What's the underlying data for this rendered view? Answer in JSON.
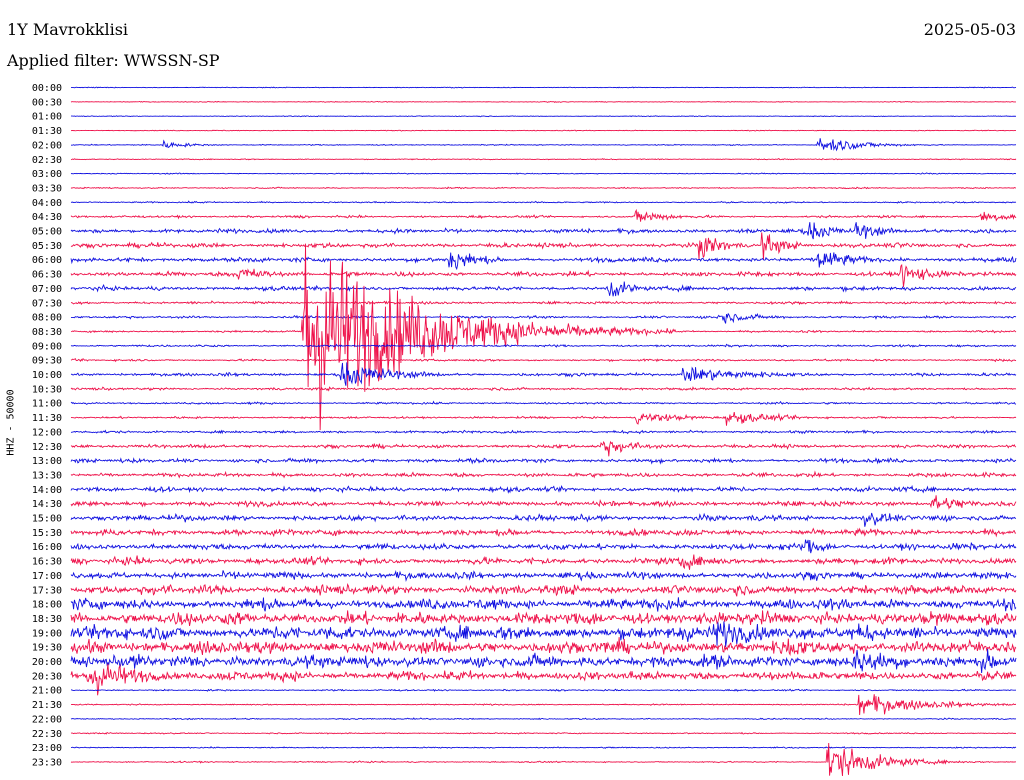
{
  "header": {
    "station": "1Y Mavrokklisi",
    "date": "2025-05-03",
    "filter": "Applied filter: WWSSN-SP"
  },
  "chart_data": {
    "type": "line",
    "subtype": "helicorder",
    "ylabel": "HHZ - 50000",
    "trace_colors": [
      "#1010e0",
      "#ee1049"
    ],
    "rows": [
      "00:00",
      "00:30",
      "01:00",
      "01:30",
      "02:00",
      "02:30",
      "03:00",
      "03:30",
      "04:00",
      "04:30",
      "05:00",
      "05:30",
      "06:00",
      "06:30",
      "07:00",
      "07:30",
      "08:00",
      "08:30",
      "09:00",
      "09:30",
      "10:00",
      "10:30",
      "11:00",
      "11:30",
      "12:00",
      "12:30",
      "13:00",
      "13:30",
      "14:00",
      "14:30",
      "15:00",
      "15:30",
      "16:00",
      "16:30",
      "17:00",
      "17:30",
      "18:00",
      "18:30",
      "19:00",
      "19:30",
      "20:00",
      "20:30",
      "21:00",
      "21:30",
      "22:00",
      "22:30",
      "23:00",
      "23:30"
    ],
    "noise_level": [
      0.3,
      0.3,
      0.3,
      0.3,
      0.4,
      0.4,
      0.4,
      0.5,
      0.6,
      0.9,
      1.6,
      1.8,
      1.8,
      1.8,
      1.6,
      1.0,
      0.9,
      0.8,
      0.8,
      0.8,
      1.2,
      1.0,
      0.8,
      0.8,
      1.0,
      1.4,
      1.6,
      1.6,
      1.8,
      2.0,
      2.2,
      2.4,
      2.4,
      2.6,
      2.8,
      3.6,
      4.2,
      5.0,
      5.5,
      5.2,
      4.8,
      3.6,
      0.6,
      0.5,
      0.5,
      0.5,
      0.5,
      0.5
    ],
    "events": [
      {
        "row": "02:00",
        "time_min": 23.7,
        "amplitude": 9,
        "duration_min": 1.3
      },
      {
        "row": "02:00",
        "time_min": 2.9,
        "amplitude": 4,
        "duration_min": 0.8
      },
      {
        "row": "04:30",
        "time_min": 17.9,
        "amplitude": 8,
        "duration_min": 1.0
      },
      {
        "row": "04:30",
        "time_min": 28.8,
        "amplitude": 6,
        "duration_min": 1.4
      },
      {
        "row": "05:00",
        "time_min": 23.3,
        "amplitude": 12,
        "duration_min": 0.8
      },
      {
        "row": "05:00",
        "time_min": 24.9,
        "amplitude": 10,
        "duration_min": 0.8
      },
      {
        "row": "05:30",
        "time_min": 19.9,
        "amplitude": 16,
        "duration_min": 0.7
      },
      {
        "row": "05:30",
        "time_min": 21.9,
        "amplitude": 14,
        "duration_min": 0.7
      },
      {
        "row": "06:00",
        "time_min": 12.0,
        "amplitude": 14,
        "duration_min": 0.8
      },
      {
        "row": "06:00",
        "time_min": 23.7,
        "amplitude": 12,
        "duration_min": 1.0
      },
      {
        "row": "06:30",
        "time_min": 5.3,
        "amplitude": 10,
        "duration_min": 0.8
      },
      {
        "row": "06:30",
        "time_min": 26.3,
        "amplitude": 12,
        "duration_min": 1.0
      },
      {
        "row": "07:00",
        "time_min": 17.0,
        "amplitude": 12,
        "duration_min": 0.7
      },
      {
        "row": "08:00",
        "time_min": 20.5,
        "amplitude": 6,
        "duration_min": 1.3
      },
      {
        "row": "08:30",
        "time_min": 7.3,
        "amplitude": 105,
        "duration_min": 3.0
      },
      {
        "row": "10:00",
        "time_min": 8.5,
        "amplitude": 14,
        "duration_min": 1.5
      },
      {
        "row": "10:00",
        "time_min": 19.4,
        "amplitude": 8,
        "duration_min": 2.3
      },
      {
        "row": "11:30",
        "time_min": 17.9,
        "amplitude": 6,
        "duration_min": 1.5
      },
      {
        "row": "11:30",
        "time_min": 20.8,
        "amplitude": 7,
        "duration_min": 1.5
      },
      {
        "row": "12:30",
        "time_min": 16.8,
        "amplitude": 10,
        "duration_min": 1.1
      },
      {
        "row": "14:30",
        "time_min": 27.3,
        "amplitude": 9,
        "duration_min": 1.3
      },
      {
        "row": "15:00",
        "time_min": 25.1,
        "amplitude": 9,
        "duration_min": 1.0
      },
      {
        "row": "16:00",
        "time_min": 23.3,
        "amplitude": 10,
        "duration_min": 0.7
      },
      {
        "row": "16:30",
        "time_min": 19.3,
        "amplitude": 10,
        "duration_min": 0.8
      },
      {
        "row": "19:00",
        "time_min": 20.4,
        "amplitude": 14,
        "duration_min": 2.0
      },
      {
        "row": "19:30",
        "time_min": 22.7,
        "amplitude": 12,
        "duration_min": 1.2
      },
      {
        "row": "20:00",
        "time_min": 24.8,
        "amplitude": 14,
        "duration_min": 1.6
      },
      {
        "row": "20:00",
        "time_min": 28.9,
        "amplitude": 12,
        "duration_min": 1.0
      },
      {
        "row": "20:30",
        "time_min": 0.5,
        "amplitude": 22,
        "duration_min": 1.3
      },
      {
        "row": "21:30",
        "time_min": 25.0,
        "amplitude": 12,
        "duration_min": 1.8
      },
      {
        "row": "23:30",
        "time_min": 24.0,
        "amplitude": 20,
        "duration_min": 1.4
      }
    ]
  }
}
